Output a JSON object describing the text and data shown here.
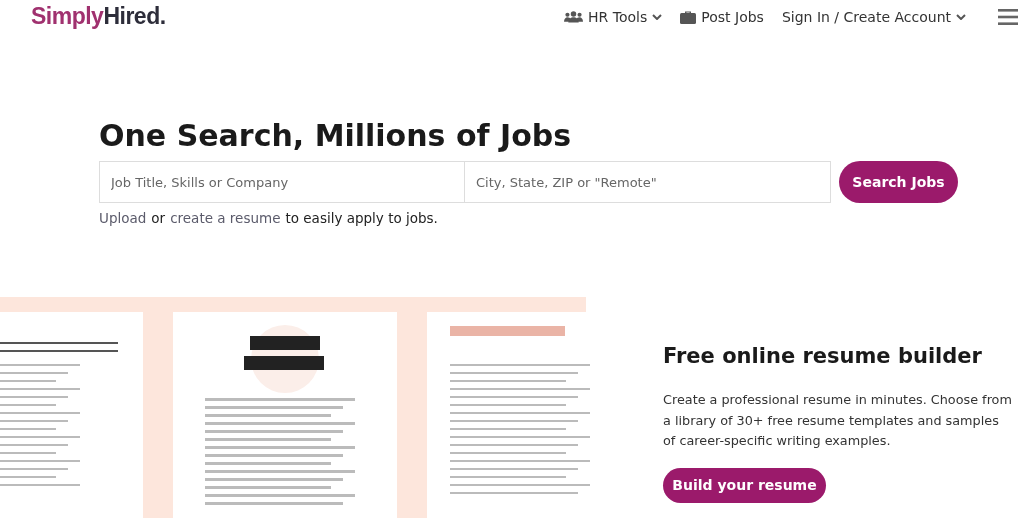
{
  "header": {
    "logo": {
      "first": "Simply",
      "second": "Hired."
    },
    "nav": [
      {
        "label": "HR Tools",
        "kind": "users",
        "dropdown": true
      },
      {
        "label": "Post Jobs",
        "kind": "briefcase",
        "dropdown": false
      },
      {
        "label": "Sign In / Create Account",
        "kind": "none",
        "dropdown": true
      }
    ]
  },
  "hero": {
    "title": "One Search, Millions of Jobs",
    "search": {
      "what_placeholder": "Job Title, Skills or Company",
      "where_placeholder": "City, State, ZIP or \"Remote\"",
      "button": "Search Jobs"
    },
    "upload_line": {
      "link_1": "Upload",
      "text_1": "or",
      "link_2": "create a resume",
      "text_2": "to easily apply to jobs."
    }
  },
  "resume_section": {
    "title": "Free online resume builder",
    "text": "Create a professional resume in minutes. Choose from a library of 30+ free resume templates and samples of career-specific writing examples.",
    "button": "Build your resume"
  }
}
